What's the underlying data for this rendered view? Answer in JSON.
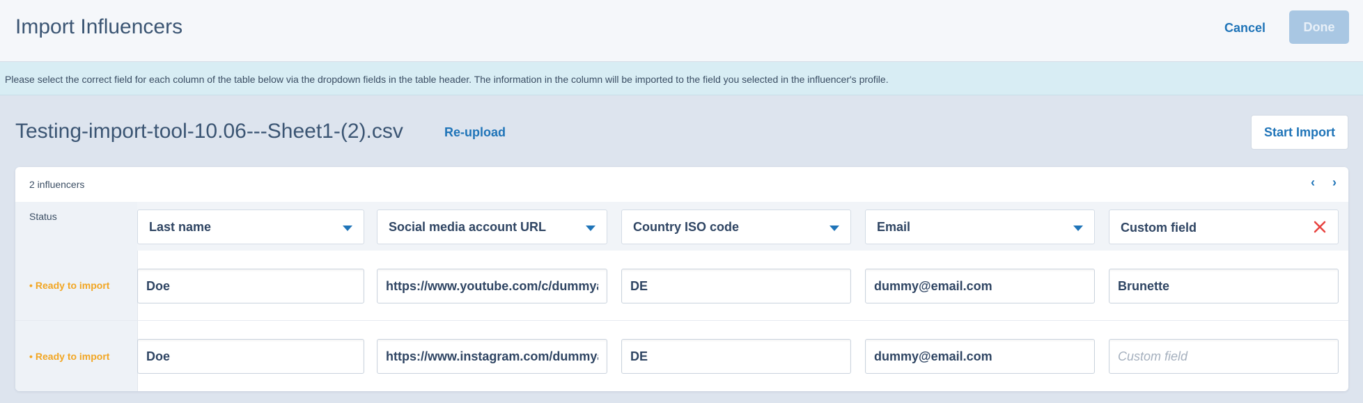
{
  "header": {
    "title": "Import Influencers",
    "cancel_label": "Cancel",
    "done_label": "Done"
  },
  "banner": {
    "text": "Please select the correct field for each column of the table below via the dropdown fields in the table header. The information in the column will be imported to the field you selected in the influencer's profile."
  },
  "file": {
    "name": "Testing-import-tool-10.06---Sheet1-(2).csv",
    "reupload_label": "Re-upload",
    "start_import_label": "Start Import"
  },
  "table": {
    "count_label": "2 influencers",
    "pager_prev": "‹",
    "pager_next": "›",
    "status_header": "Status",
    "columns": [
      {
        "label": "Last name"
      },
      {
        "label": "Social media account URL"
      },
      {
        "label": "Country ISO code"
      },
      {
        "label": "Email"
      },
      {
        "label": "Custom field"
      }
    ],
    "rows": [
      {
        "status": "Ready to import",
        "cells": [
          "Doe",
          "https://www.youtube.com/c/dummyaccount",
          "DE",
          "dummy@email.com",
          "Brunette"
        ]
      },
      {
        "status": "Ready to import",
        "cells": [
          "Doe",
          "https://www.instagram.com/dummyaccount",
          "DE",
          "dummy@email.com",
          ""
        ]
      }
    ],
    "custom_field_placeholder": "Custom field"
  },
  "colors": {
    "accent": "#1f74b8",
    "status_ready": "#f2a623",
    "clear": "#e8423f",
    "done_disabled": "#a9c7e3"
  },
  "icons": {
    "clear": "close-icon",
    "dropdown": "chevron-down-icon"
  }
}
